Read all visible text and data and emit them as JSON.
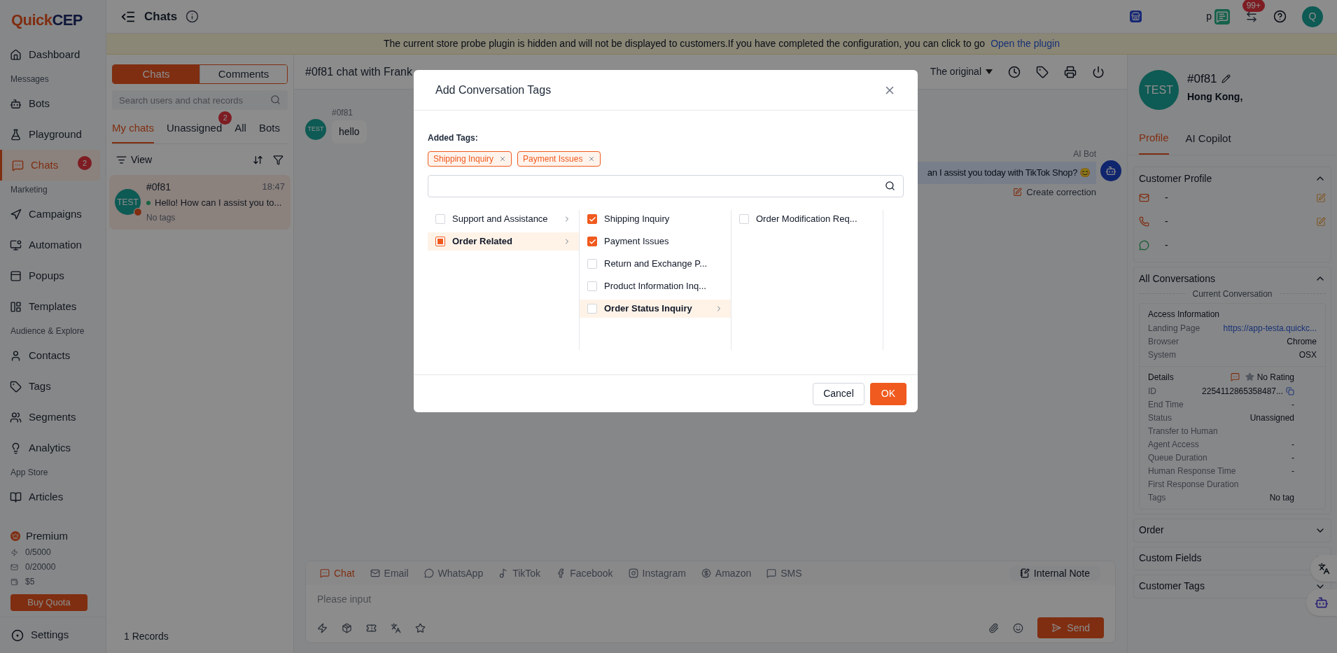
{
  "logo": {
    "first": "Quick",
    "second": "CEP"
  },
  "sidebar": {
    "nav": [
      {
        "kind": "item",
        "label": "Dashboard",
        "selected": false
      },
      {
        "kind": "section",
        "label": "Messages"
      },
      {
        "kind": "item",
        "label": "Bots",
        "selected": false
      },
      {
        "kind": "item",
        "label": "Playground",
        "selected": false
      },
      {
        "kind": "item",
        "label": "Chats",
        "selected": true,
        "badge": "2"
      },
      {
        "kind": "section",
        "label": "Marketing"
      },
      {
        "kind": "item",
        "label": "Campaigns",
        "selected": false
      },
      {
        "kind": "item",
        "label": "Automation",
        "selected": false
      },
      {
        "kind": "item",
        "label": "Popups",
        "selected": false
      },
      {
        "kind": "item",
        "label": "Templates",
        "selected": false
      },
      {
        "kind": "section",
        "label": "Audience & Explore"
      },
      {
        "kind": "item",
        "label": "Contacts",
        "selected": false
      },
      {
        "kind": "item",
        "label": "Tags",
        "selected": false
      },
      {
        "kind": "item",
        "label": "Segments",
        "selected": false
      },
      {
        "kind": "item",
        "label": "Analytics",
        "selected": false
      },
      {
        "kind": "section",
        "label": "App Store"
      },
      {
        "kind": "item",
        "label": "Articles",
        "selected": false
      }
    ],
    "plan": {
      "name": "Premium",
      "quotas": [
        "0/5000",
        "0/20000",
        "$5"
      ],
      "button": "Buy Quota"
    },
    "settings": "Settings"
  },
  "header": {
    "title": "Chats",
    "user_label": "p",
    "notification_badge": "99+",
    "avatar": "Q"
  },
  "banner": {
    "text": "The current store probe plugin is hidden and will not be displayed to customers.If you have completed the configuration, you can click to go",
    "link": "Open the plugin"
  },
  "chat_list": {
    "tabs": [
      {
        "label": "Chats",
        "selected": true
      },
      {
        "label": "Comments",
        "selected": false
      }
    ],
    "search_placeholder": "Search users and chat records",
    "filters": [
      {
        "label": "My chats",
        "selected": true
      },
      {
        "label": "Unassigned",
        "selected": false,
        "badge": "2"
      },
      {
        "label": "All",
        "selected": false
      },
      {
        "label": "Bots",
        "selected": false
      }
    ],
    "view_label": "View",
    "chats": [
      {
        "name": "#0f81",
        "time": "18:47",
        "preview": "Hello! How can I assist you to...",
        "tags": "No tags",
        "avatar": "TEST",
        "selected": true,
        "online": true
      }
    ],
    "records": "1 Records"
  },
  "conversation": {
    "title": "#0f81 chat with Frank",
    "translation": "The original",
    "messages": [
      {
        "kind": "user",
        "sender": "#0f81",
        "avatar": "TEST",
        "text": "hello"
      },
      {
        "kind": "bot",
        "sender": "AI Bot",
        "text": "an I assist you today with TikTok Shop? 😊",
        "action": "Create correction"
      }
    ],
    "channels": [
      {
        "label": "Chat",
        "selected": true
      },
      {
        "label": "Email",
        "selected": false
      },
      {
        "label": "WhatsApp",
        "selected": false
      },
      {
        "label": "TikTok",
        "selected": false
      },
      {
        "label": "Facebook",
        "selected": false
      },
      {
        "label": "Instagram",
        "selected": false
      },
      {
        "label": "Amazon",
        "selected": false
      },
      {
        "label": "SMS",
        "selected": false
      }
    ],
    "internal_note": "Internal Note",
    "input_placeholder": "Please input",
    "send": "Send"
  },
  "profile": {
    "avatar": "TEST",
    "name": "#0f81",
    "location": "Hong Kong,",
    "tabs": [
      {
        "label": "Profile",
        "selected": true
      },
      {
        "label": "AI Copilot",
        "selected": false
      }
    ],
    "customer_profile": {
      "title": "Customer Profile",
      "expanded": true,
      "fields": [
        "-",
        "-",
        "-"
      ]
    },
    "conversations": {
      "title": "All Conversations",
      "expanded": true,
      "divider": "Current Conversation",
      "access": {
        "title": "Access Information",
        "rows": [
          {
            "label": "Landing Page",
            "value": "https://app-testa.quickc...",
            "kind": "link"
          },
          {
            "label": "Browser",
            "value": "Chrome",
            "kind": "text"
          },
          {
            "label": "System",
            "value": "OSX",
            "kind": "text"
          }
        ]
      },
      "details": {
        "title": "Details",
        "rating": "No Rating",
        "rows": [
          {
            "label": "ID",
            "value": "2254112865358487...",
            "kind": "copy"
          },
          {
            "label": "End Time",
            "value": "-",
            "kind": "text"
          },
          {
            "label": "Status",
            "value": "Unassigned",
            "kind": "text"
          },
          {
            "label": "Transfer to Human"
          },
          {
            "label": "Agent Access",
            "value": "-",
            "kind": "text"
          },
          {
            "label": "Queue Duration",
            "value": "-",
            "kind": "text"
          },
          {
            "label": "Human Response Time",
            "value": "-",
            "kind": "text"
          },
          {
            "label": "First Response Duration"
          },
          {
            "label": "Tags",
            "value": "No tag",
            "kind": "text"
          }
        ]
      }
    },
    "sections": [
      {
        "title": "Order",
        "expanded": false
      },
      {
        "title": "Custom Fields",
        "expanded": false
      },
      {
        "title": "Customer Tags",
        "expanded": false
      }
    ]
  },
  "dialog": {
    "title": "Add Conversation Tags",
    "added_label": "Added Tags:",
    "added_tags": [
      "Shipping Inquiry",
      "Payment Issues"
    ],
    "columns": [
      [
        {
          "label": "Support and Assistance",
          "checked": false,
          "indeterminate": false,
          "has_children": true,
          "selected": false
        },
        {
          "label": "Order Related",
          "checked": false,
          "indeterminate": true,
          "has_children": true,
          "selected": true
        }
      ],
      [
        {
          "label": "Shipping Inquiry",
          "checked": true,
          "indeterminate": false,
          "has_children": false,
          "selected": false
        },
        {
          "label": "Payment Issues",
          "checked": true,
          "indeterminate": false,
          "has_children": false,
          "selected": false
        },
        {
          "label": "Return and Exchange P...",
          "checked": false,
          "indeterminate": false,
          "has_children": false,
          "selected": false
        },
        {
          "label": "Product Information Inq...",
          "checked": false,
          "indeterminate": false,
          "has_children": false,
          "selected": false
        },
        {
          "label": "Order Status Inquiry",
          "checked": false,
          "indeterminate": false,
          "has_children": true,
          "selected": true
        }
      ],
      [
        {
          "label": "Order Modification Req...",
          "checked": false,
          "indeterminate": false,
          "has_children": false,
          "selected": false
        }
      ]
    ],
    "cancel": "Cancel",
    "ok": "OK"
  }
}
